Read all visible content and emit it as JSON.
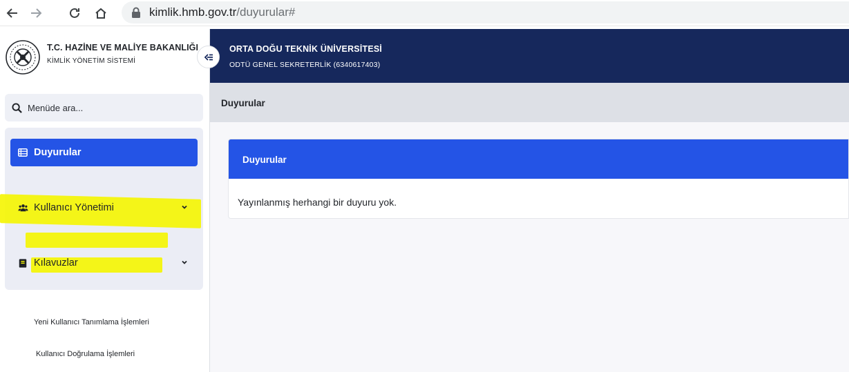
{
  "browser": {
    "url_domain": "kimlik.hmb.gov.tr",
    "url_path": "/duyurular#"
  },
  "brand": {
    "title": "T.C. HAZİNE VE MALİYE BAKANLIĞI",
    "subtitle": "KİMLİK YÖNETİM SİSTEMİ"
  },
  "search": {
    "placeholder": "Menüde ara..."
  },
  "menu": {
    "items": [
      {
        "label": "Duyurular",
        "icon": "table-icon",
        "active": true
      },
      {
        "label": "Kullanıcı Yönetimi",
        "icon": "users-icon",
        "has_children": true
      },
      {
        "label": "Kılavuzlar",
        "icon": "book-icon",
        "has_children": true,
        "expanded": true
      }
    ],
    "sub_items": [
      {
        "label": "Yeni Kullanıcı Tanımlama İşlemleri"
      },
      {
        "label": "Kullanıcı Doğrulama İşlemleri"
      }
    ]
  },
  "header": {
    "org_name": "ORTA DOĞU TEKNİK ÜNİVERSİTESİ",
    "org_unit": "ODTÜ GENEL SEKRETERLİK (6340617403)"
  },
  "breadcrumb": {
    "title": "Duyurular"
  },
  "card": {
    "title": "Duyurular",
    "empty_message": "Yayınlanmış herhangi bir duyuru yok."
  },
  "colors": {
    "primary": "#2454e6",
    "header_bg": "#16285c",
    "highlight": "#f5f500"
  }
}
